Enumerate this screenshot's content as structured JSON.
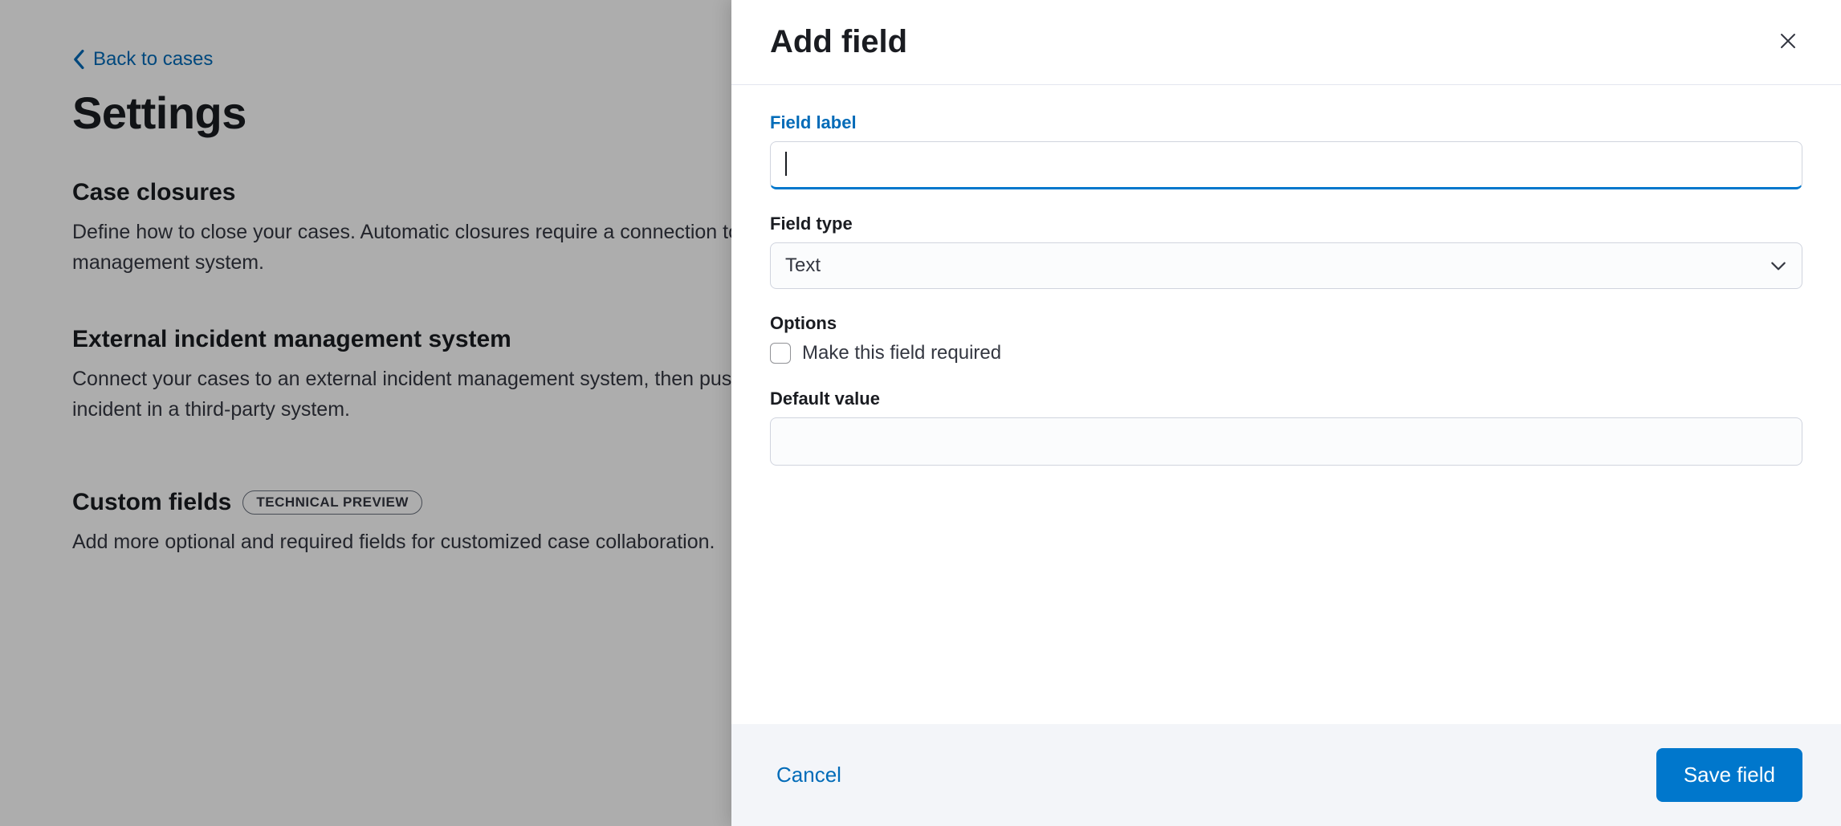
{
  "background": {
    "back_link": "Back to cases",
    "page_title": "Settings",
    "sections": [
      {
        "title": "Case closures",
        "desc": "Define how to close your cases. Automatic closures require a connection to an external incident management system."
      },
      {
        "title": "External incident management system",
        "desc": "Connect your cases to an external incident management system, then push case data as an incident in a third-party system."
      },
      {
        "title": "Custom fields",
        "badge": "TECHNICAL PREVIEW",
        "desc": "Add more optional and required fields for customized case collaboration."
      }
    ]
  },
  "flyout": {
    "title": "Add field",
    "field_label": {
      "label": "Field label",
      "value": ""
    },
    "field_type": {
      "label": "Field type",
      "selected": "Text"
    },
    "options": {
      "label": "Options",
      "checkbox_label": "Make this field required",
      "checked": false
    },
    "default_value": {
      "label": "Default value",
      "value": ""
    },
    "footer": {
      "cancel": "Cancel",
      "save": "Save field"
    }
  }
}
